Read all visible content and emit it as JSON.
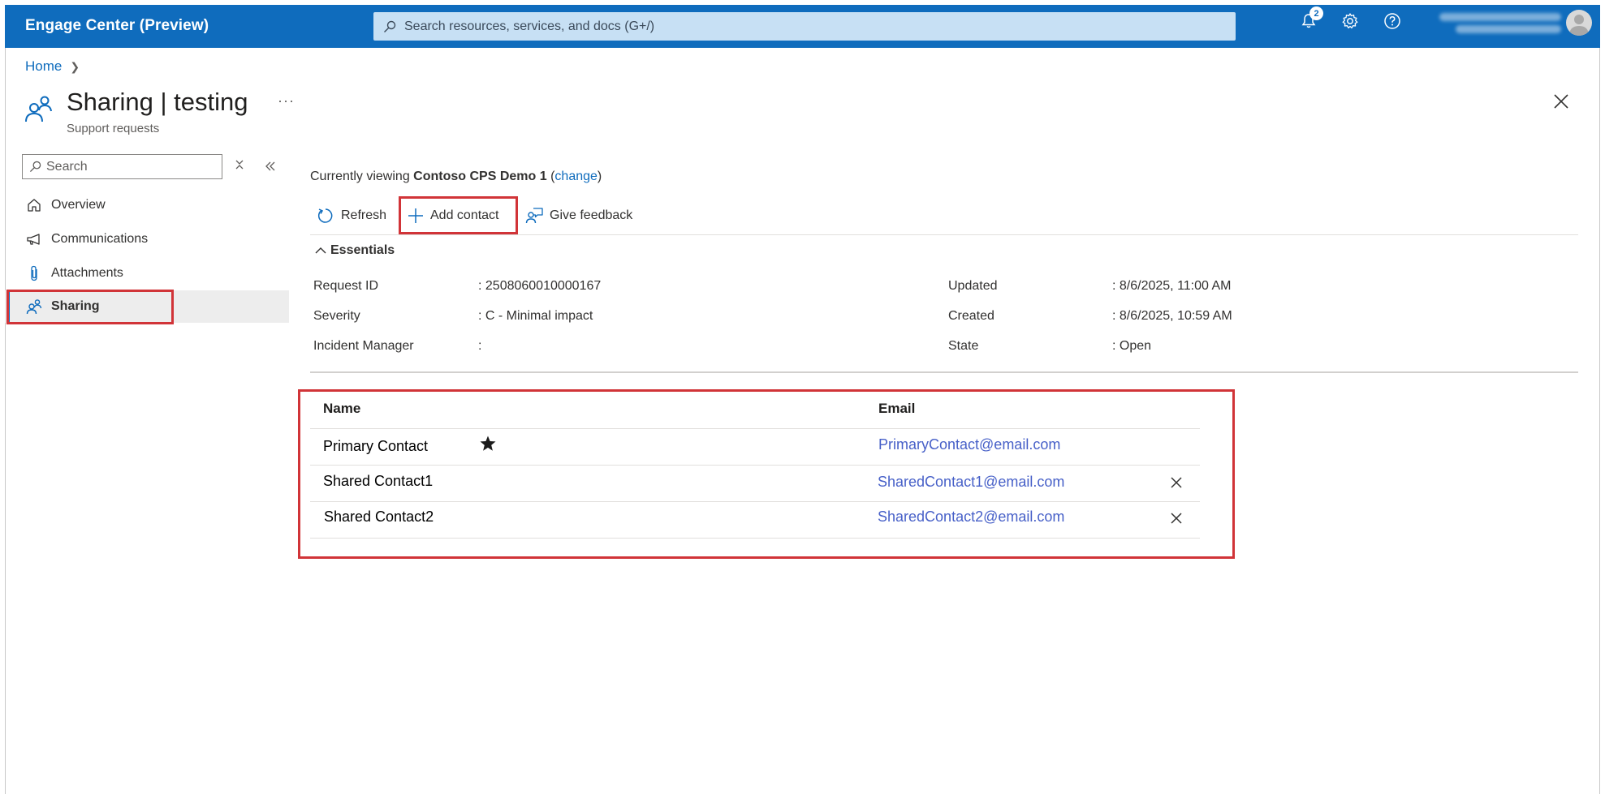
{
  "app": {
    "title": "Engage Center (Preview)",
    "search_placeholder": "Search resources, services, and docs (G+/)",
    "notification_count": "2"
  },
  "breadcrumb": {
    "home": "Home"
  },
  "page": {
    "title": "Sharing | testing",
    "subtitle": "Support requests",
    "more": "···"
  },
  "sidebar": {
    "search_placeholder": "Search",
    "items": [
      {
        "label": "Overview",
        "icon": "home-icon"
      },
      {
        "label": "Communications",
        "icon": "megaphone-icon"
      },
      {
        "label": "Attachments",
        "icon": "paperclip-icon"
      },
      {
        "label": "Sharing",
        "icon": "people-icon",
        "active": true
      }
    ]
  },
  "viewing": {
    "prefix": "Currently viewing",
    "name": "Contoso CPS Demo 1",
    "change_link": "change"
  },
  "toolbar": {
    "refresh": "Refresh",
    "add_contact": "Add contact",
    "give_feedback": "Give feedback"
  },
  "essentials": {
    "toggle_label": "Essentials",
    "left": [
      {
        "label": "Request ID",
        "value": ": 2508060010000167"
      },
      {
        "label": "Severity",
        "value": ": C - Minimal impact"
      },
      {
        "label": "Incident Manager",
        "value": ":"
      }
    ],
    "right": [
      {
        "label": "Updated",
        "value": ": 8/6/2025, 11:00 AM"
      },
      {
        "label": "Created",
        "value": ": 8/6/2025, 10:59 AM"
      },
      {
        "label": "State",
        "value": ": Open"
      }
    ]
  },
  "contacts": {
    "columns": {
      "name": "Name",
      "email": "Email"
    },
    "rows": [
      {
        "name": "Primary Contact",
        "email": "PrimaryContact@email.com",
        "primary": true
      },
      {
        "name": "Shared Contact1",
        "email": "SharedContact1@email.com",
        "removable": true
      },
      {
        "name": "Shared Contact2",
        "email": "SharedContact2@email.com",
        "removable": true
      }
    ]
  },
  "colors": {
    "brand": "#0f6cbd",
    "highlight": "#d13438",
    "link": "#4760c8"
  }
}
